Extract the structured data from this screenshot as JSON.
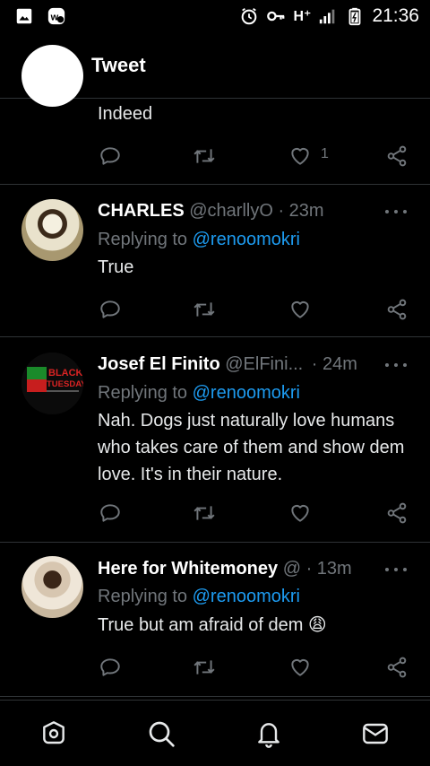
{
  "status_bar": {
    "network": "H⁺",
    "time": "21:36",
    "icons": [
      "image-icon",
      "app-badge-icon",
      "alarm-icon",
      "key-icon",
      "signal-icon",
      "battery-icon"
    ]
  },
  "header": {
    "title": "Tweet"
  },
  "tweets": [
    {
      "text": "Indeed",
      "like_count": "1"
    },
    {
      "name": "CHARLES",
      "handle": "@charllyO",
      "time": "· 23m",
      "replying_prefix": "Replying to",
      "replying_to": "@renoomokri",
      "text": "True"
    },
    {
      "name": "Josef El Finito",
      "handle": "@ElFini...",
      "time": "· 24m",
      "avatar_text": [
        "BLACK",
        "TUESDAY"
      ],
      "replying_prefix": "Replying to",
      "replying_to": "@renoomokri",
      "text": "Nah. Dogs just naturally love humans who takes care of them and show dem love. It's in their nature."
    },
    {
      "name": "Here for Whitemoney",
      "handle": "@",
      "time": "· 13m",
      "replying_prefix": "Replying to",
      "replying_to": "@renoomokri",
      "text": "True but am afraid of dem 😩"
    }
  ],
  "bottom_nav": [
    "home-icon",
    "search-icon",
    "notifications-icon",
    "messages-icon"
  ],
  "colors": {
    "background": "#000000",
    "accent": "#1d9bf0",
    "muted": "#71767b",
    "divider": "#2f3336"
  }
}
